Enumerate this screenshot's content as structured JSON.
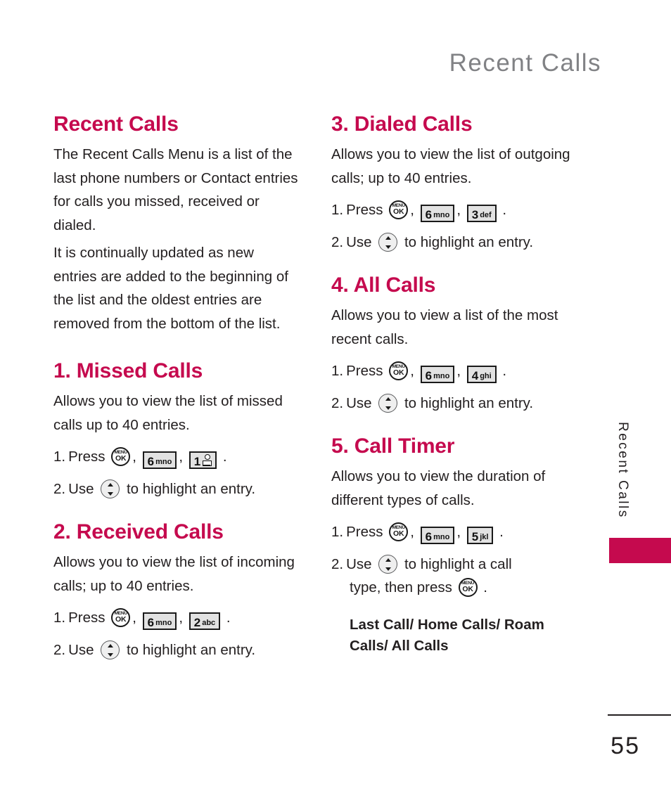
{
  "running_head": "Recent Calls",
  "accent_color": "#c50a4e",
  "header_gray": "#818285",
  "icons": {
    "menu_ok_top": "MENU",
    "menu_ok_bottom": "OK",
    "nav_name": "navigation-up-down-key"
  },
  "left_column": {
    "intro": {
      "title": "Recent Calls",
      "paragraph_1": "The Recent Calls Menu is a list of the last phone numbers or Contact entries for calls you missed, received or dialed.",
      "paragraph_2": "It is continually updated as new entries are added to the beginning of the list and the oldest entries are removed from the bottom of the list."
    },
    "section_1": {
      "title": "1. Missed Calls",
      "description": "Allows you to view the list of missed calls up to 40 entries.",
      "step1_num": "1.",
      "step1_press": "Press",
      "step1_key1_digit": "6",
      "step1_key1_letters": "mno",
      "step1_key2_digit": "1",
      "step1_key2_letters": "",
      "step1_comma": ",",
      "step1_period": ".",
      "step2_num": "2.",
      "step2_use": "Use",
      "step2_tail": "to highlight an entry."
    },
    "section_2": {
      "title": "2. Received Calls",
      "description": "Allows you to view the list of incoming calls; up to 40 entries.",
      "step1_num": "1.",
      "step1_press": "Press",
      "step1_key1_digit": "6",
      "step1_key1_letters": "mno",
      "step1_key2_digit": "2",
      "step1_key2_letters": "abc",
      "step1_comma": ",",
      "step1_period": ".",
      "step2_num": "2.",
      "step2_use": "Use",
      "step2_tail": "to highlight an entry."
    }
  },
  "right_column": {
    "section_3": {
      "title": "3. Dialed Calls",
      "description": "Allows you to view the list of outgoing calls; up to 40 entries.",
      "step1_num": "1.",
      "step1_press": "Press",
      "step1_key1_digit": "6",
      "step1_key1_letters": "mno",
      "step1_key2_digit": "3",
      "step1_key2_letters": "def",
      "step1_comma": ",",
      "step1_period": ".",
      "step2_num": "2.",
      "step2_use": "Use",
      "step2_tail": "to highlight an entry."
    },
    "section_4": {
      "title": "4. All Calls",
      "description": "Allows you to view a list of the most recent calls.",
      "step1_num": "1.",
      "step1_press": "Press",
      "step1_key1_digit": "6",
      "step1_key1_letters": "mno",
      "step1_key2_digit": "4",
      "step1_key2_letters": "ghi",
      "step1_comma": ",",
      "step1_period": ".",
      "step2_num": "2.",
      "step2_use": "Use",
      "step2_tail": "to highlight an entry."
    },
    "section_5": {
      "title": "5. Call Timer",
      "description": "Allows you to view the duration of different types of calls.",
      "step1_num": "1.",
      "step1_press": "Press",
      "step1_key1_digit": "6",
      "step1_key1_letters": "mno",
      "step1_key2_digit": "5",
      "step1_key2_letters": "jkl",
      "step1_comma": ",",
      "step1_period": ".",
      "step2_num": "2.",
      "step2_use": "Use",
      "step2_mid": "to highlight a call",
      "step2_cont": "type, then press",
      "step2_period": ".",
      "options_bold": "Last Call/ Home Calls/ Roam Calls/ All Calls"
    }
  },
  "side_tab": {
    "label": "Recent Calls"
  },
  "folio": {
    "page_number": "55"
  }
}
